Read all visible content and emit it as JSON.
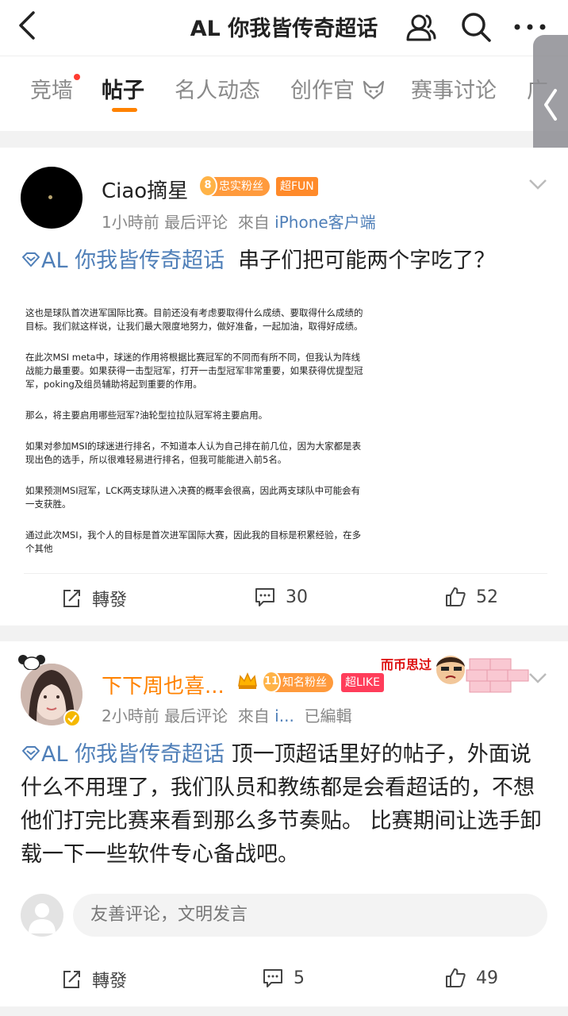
{
  "header": {
    "title": "AL 你我皆传奇超话",
    "back_icon": "back-chevron-icon",
    "icons": [
      "members-icon",
      "search-icon",
      "more-icon"
    ]
  },
  "tabs": [
    {
      "label": "竞墙",
      "has_dot": true
    },
    {
      "label": "帖子",
      "active": true
    },
    {
      "label": "名人动态"
    },
    {
      "label": "创作官"
    },
    {
      "label": "赛事讨论"
    },
    {
      "label": "广"
    }
  ],
  "posts": [
    {
      "username": "Ciao摘星",
      "fan_level": "8",
      "fan_badge": "忠实粉丝",
      "super_badge": "超FUN",
      "meta": {
        "time": "1小時前",
        "label": "最后评论",
        "from": "來自",
        "source": "iPhone客户端"
      },
      "topic": "AL 你我皆传奇超话",
      "text": "串子们把可能两个字吃了？",
      "image_paragraphs": [
        "这也是球队首次进军国际比赛。目前还没有考虑要取得什么成绩、要取得什么成绩的目标。我们就这样说，让我们最大限度地努力，做好准备，一起加油，取得好成绩。",
        "在此次MSI meta中，球迷的作用将根据比赛冠军的不同而有所不同，但我认为阵线战能力最重要。如果获得一击型冠军，打开一击型冠军非常重要，如果获得优提型冠军，poking及组员辅助将起到重要的作用。",
        "那么，将主要启用哪些冠军?油轮型拉拉队冠军将主要启用。",
        "如果对参加MSI的球迷进行排名，不知道本人认为自己排在前几位，因为大家都是表现出色的选手，所以很难轻易进行排名，但我可能能进入前5名。",
        "如果预测MSI冠军，LCK两支球队进入决赛的概率会很高，因此两支球队中可能会有一支获胜。",
        "通过此次MSI，我个人的目标是首次进军国际大赛，因此我的目标是积累经验，在多个其他"
      ],
      "actions": {
        "repost": "轉發",
        "comments": "30",
        "likes": "52"
      }
    },
    {
      "username": "下下周也喜...",
      "fan_level": "11",
      "fan_badge": "知名粉丝",
      "super_badge": "超LIKE",
      "sticker_text": "而币思过",
      "meta": {
        "time": "2小時前",
        "label": "最后评论",
        "from": "來自",
        "source": "i...",
        "edited": "已編輯"
      },
      "topic": "AL 你我皆传奇超话",
      "text": "顶一顶超话里好的帖子，外面说什么不用理了，我们队员和教练都是会看超话的，不想他们打完比赛来看到那么多节奏贴。 比赛期间让选手卸载一下一些软件专心备战吧。",
      "comment_placeholder": "友善评论，文明发言",
      "actions": {
        "repost": "轉發",
        "comments": "5",
        "likes": "49"
      }
    }
  ],
  "colors": {
    "accent": "#ff8200",
    "link": "#4f7fb8",
    "username_highlight": "#ff8200"
  }
}
